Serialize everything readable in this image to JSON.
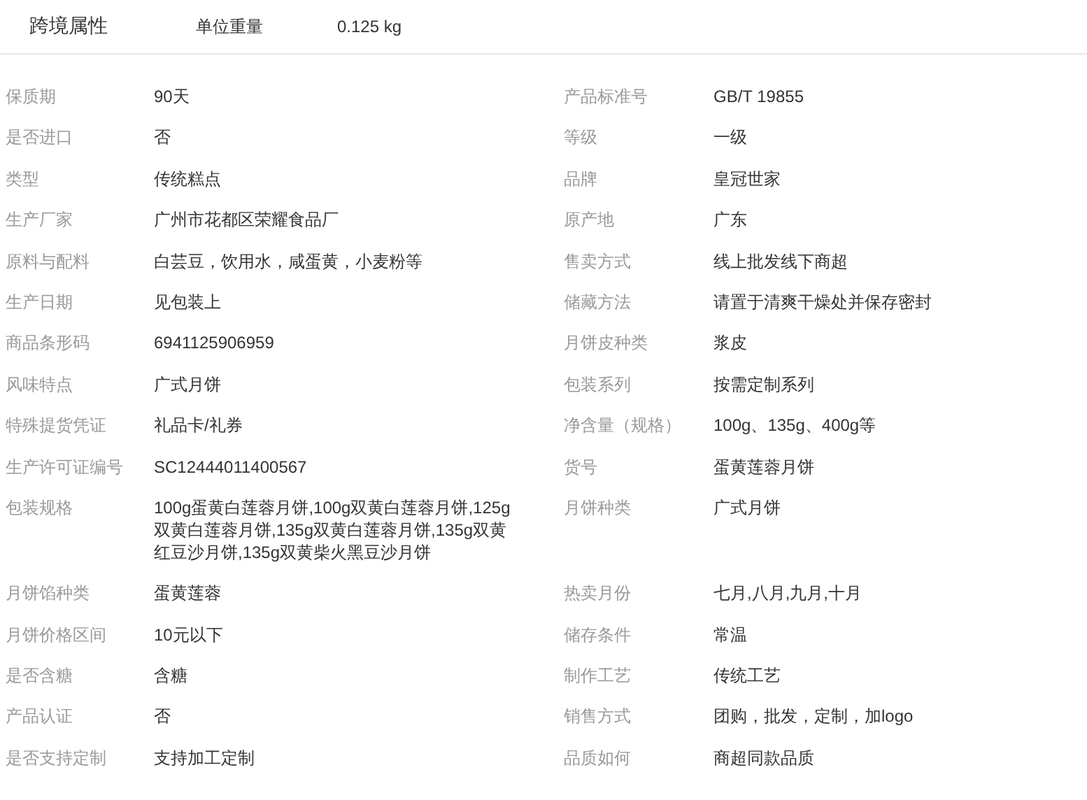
{
  "header": {
    "title": "跨境属性",
    "attributes": [
      {
        "label": "单位重量",
        "value": "0.125 kg"
      }
    ]
  },
  "attributes": [
    {
      "label": "保质期",
      "value": "90天"
    },
    {
      "label": "产品标准号",
      "value": "GB/T 19855"
    },
    {
      "label": "是否进口",
      "value": "否"
    },
    {
      "label": "等级",
      "value": "一级"
    },
    {
      "label": "类型",
      "value": "传统糕点"
    },
    {
      "label": "品牌",
      "value": "皇冠世家"
    },
    {
      "label": "生产厂家",
      "value": "广州市花都区荣耀食品厂"
    },
    {
      "label": "原产地",
      "value": "广东"
    },
    {
      "label": "原料与配料",
      "value": "白芸豆，饮用水，咸蛋黄，小麦粉等"
    },
    {
      "label": "售卖方式",
      "value": "线上批发线下商超"
    },
    {
      "label": "生产日期",
      "value": "见包装上"
    },
    {
      "label": "储藏方法",
      "value": "请置于清爽干燥处并保存密封"
    },
    {
      "label": "商品条形码",
      "value": "6941125906959"
    },
    {
      "label": "月饼皮种类",
      "value": "浆皮"
    },
    {
      "label": "风味特点",
      "value": "广式月饼"
    },
    {
      "label": "包装系列",
      "value": "按需定制系列"
    },
    {
      "label": "特殊提货凭证",
      "value": "礼品卡/礼券"
    },
    {
      "label": "净含量（规格）",
      "value": "100g、135g、400g等"
    },
    {
      "label": "生产许可证编号",
      "value": "SC12444011400567"
    },
    {
      "label": "货号",
      "value": "蛋黄莲蓉月饼"
    },
    {
      "label": "包装规格",
      "value": "100g蛋黄白莲蓉月饼,100g双黄白莲蓉月饼,125g双黄白莲蓉月饼,135g双黄白莲蓉月饼,135g双黄红豆沙月饼,135g双黄柴火黑豆沙月饼"
    },
    {
      "label": "月饼种类",
      "value": "广式月饼"
    },
    {
      "label": "月饼馅种类",
      "value": "蛋黄莲蓉"
    },
    {
      "label": "热卖月份",
      "value": "七月,八月,九月,十月"
    },
    {
      "label": "月饼价格区间",
      "value": "10元以下"
    },
    {
      "label": "储存条件",
      "value": "常温"
    },
    {
      "label": "是否含糖",
      "value": "含糖"
    },
    {
      "label": "制作工艺",
      "value": "传统工艺"
    },
    {
      "label": "产品认证",
      "value": "否"
    },
    {
      "label": "销售方式",
      "value": "团购，批发，定制，加logo"
    },
    {
      "label": "是否支持定制",
      "value": "支持加工定制"
    },
    {
      "label": "品质如何",
      "value": "商超同款品质"
    }
  ]
}
